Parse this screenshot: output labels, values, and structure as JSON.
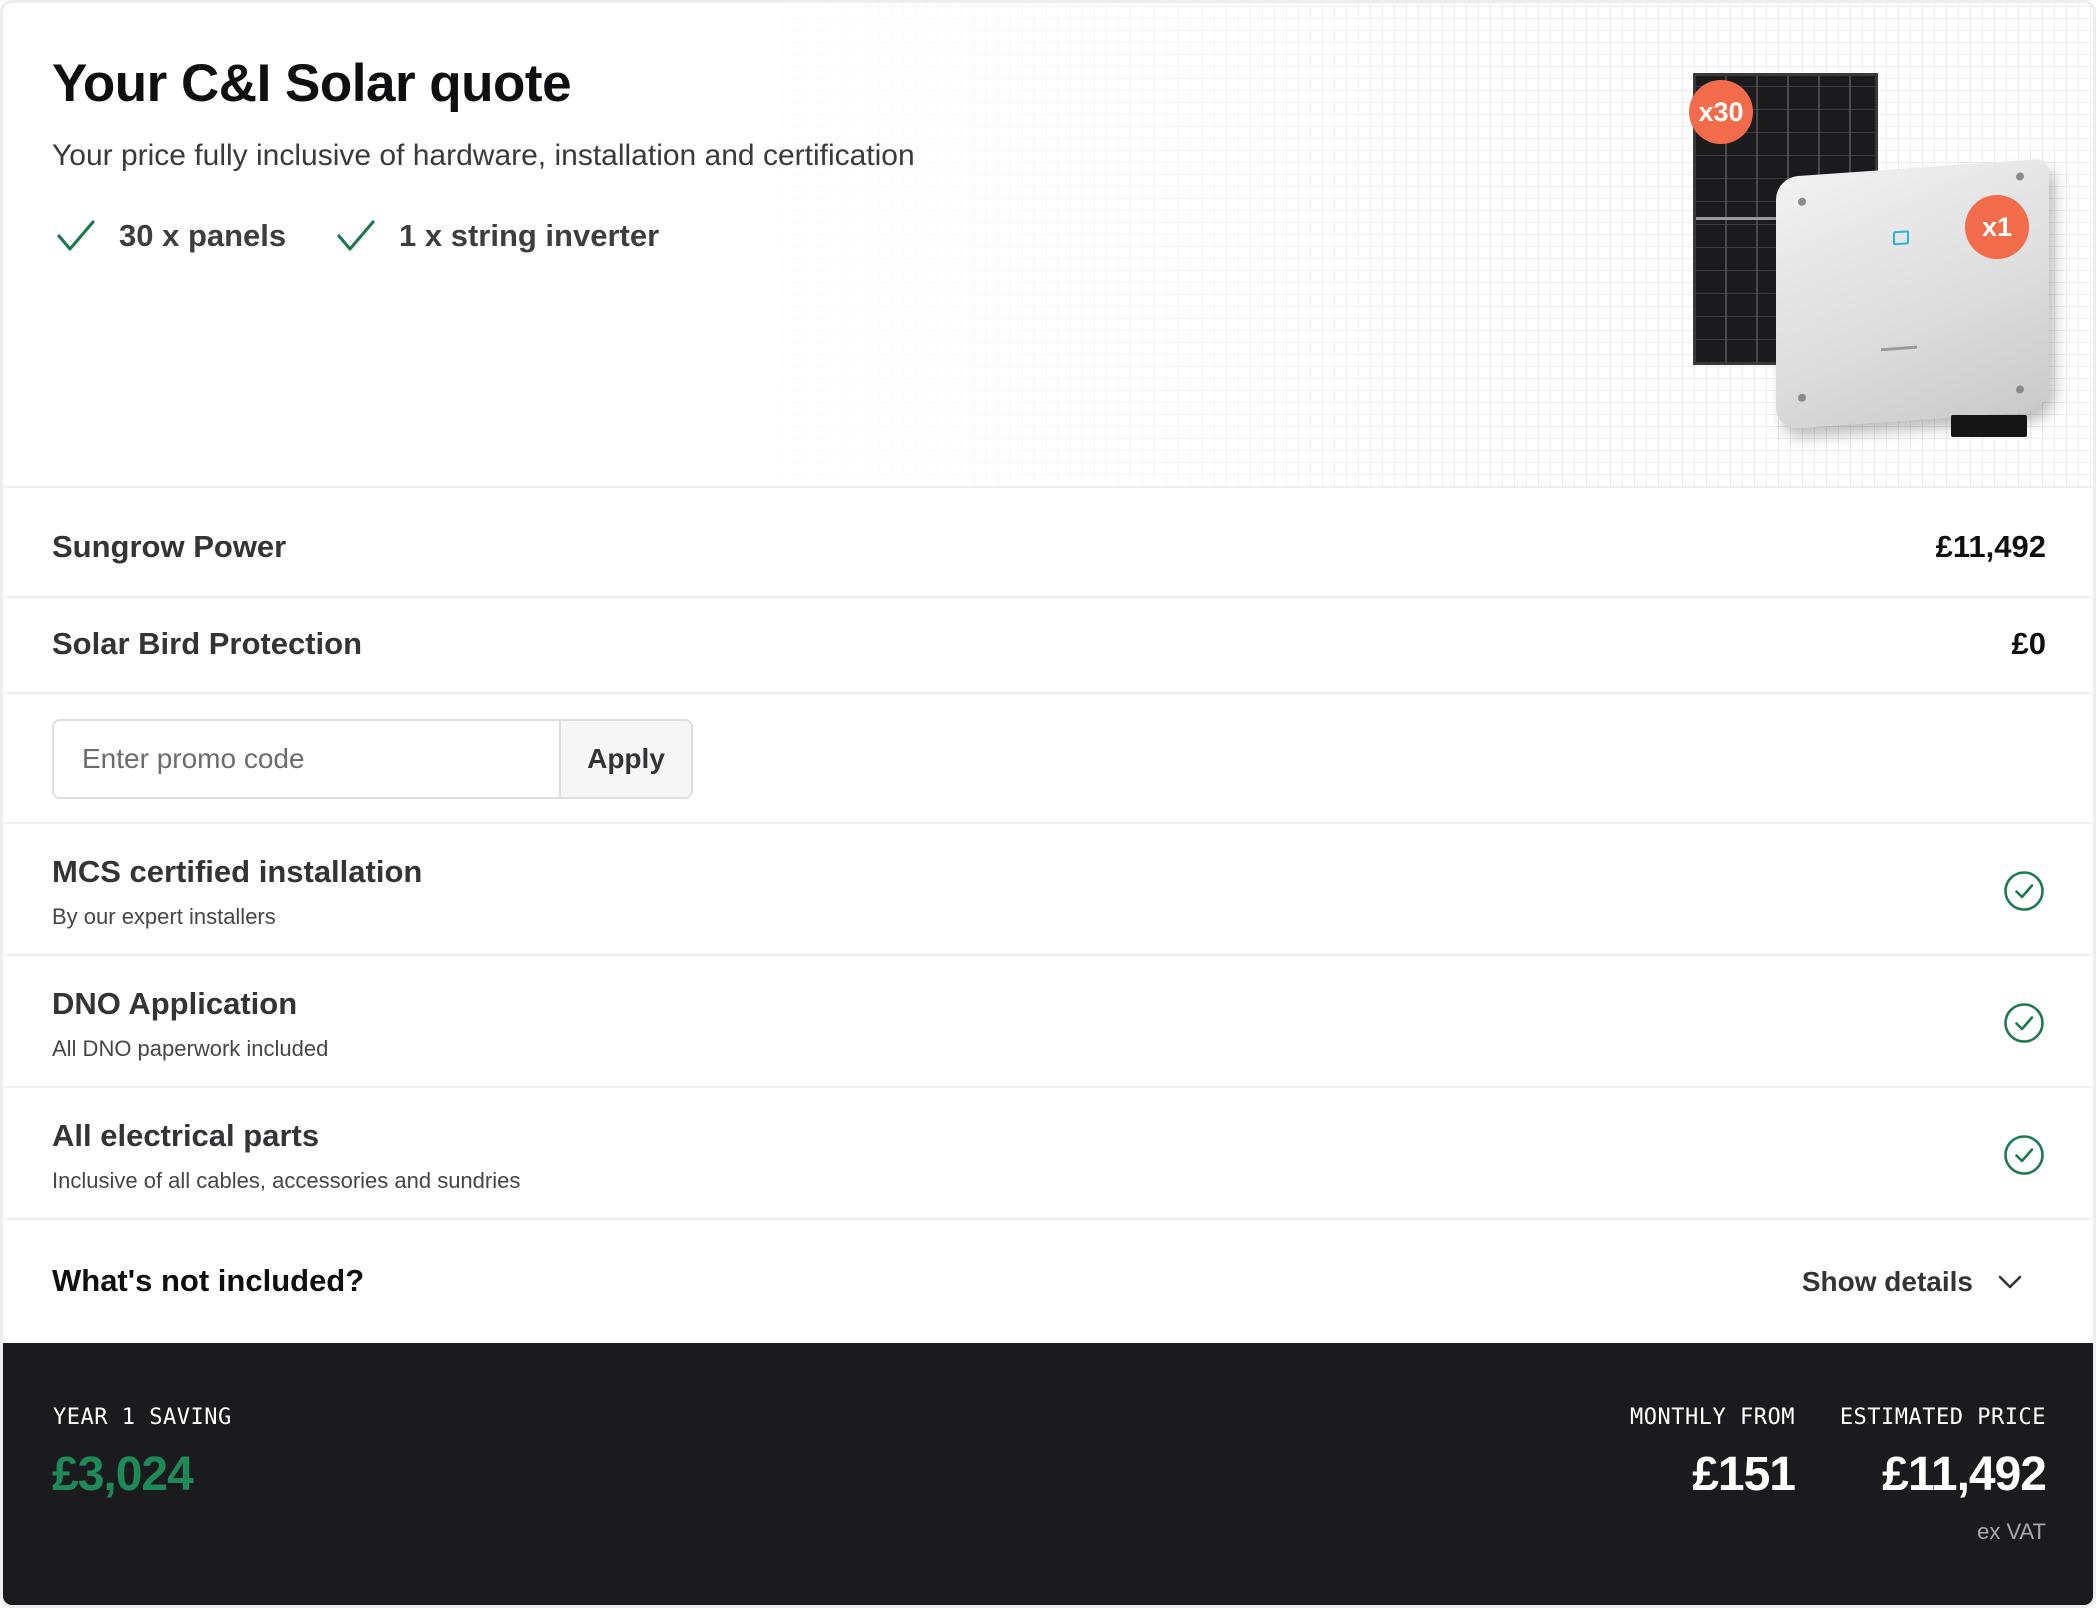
{
  "header": {
    "title": "Your C&I Solar quote",
    "subtitle": "Your price fully inclusive of hardware, installation and certification",
    "features": [
      {
        "icon": "check-icon",
        "label": "30 x panels"
      },
      {
        "icon": "check-icon",
        "label": "1 x string inverter"
      }
    ],
    "product": {
      "panel_badge": "x30",
      "inverter_badge": "x1"
    }
  },
  "line_items": [
    {
      "label": "Sungrow Power",
      "price": "£11,492"
    },
    {
      "label": "Solar Bird Protection",
      "price": "£0"
    }
  ],
  "promo": {
    "placeholder": "Enter promo code",
    "value": "",
    "button_label": "Apply"
  },
  "included": [
    {
      "title": "MCS certified installation",
      "description": "By our expert installers",
      "icon": "check-circle-icon"
    },
    {
      "title": "DNO Application",
      "description": "All DNO paperwork included",
      "icon": "check-circle-icon"
    },
    {
      "title": "All electrical parts",
      "description": "Inclusive of all cables, accessories and sundries",
      "icon": "check-circle-icon"
    }
  ],
  "not_included": {
    "label": "What's not included?",
    "toggle_label": "Show details",
    "toggle_icon": "chevron-down-icon"
  },
  "footer": {
    "saving_label": "YEAR 1 SAVING",
    "saving_value": "£3,024",
    "monthly_label": "MONTHLY FROM",
    "monthly_value": "£151",
    "price_label": "ESTIMATED PRICE",
    "price_value": "£11,492",
    "vat_note": "ex VAT"
  },
  "colors": {
    "accent_green": "#1e8a57",
    "badge_orange": "#f26b4a",
    "footer_bg": "#1b1b1f"
  }
}
